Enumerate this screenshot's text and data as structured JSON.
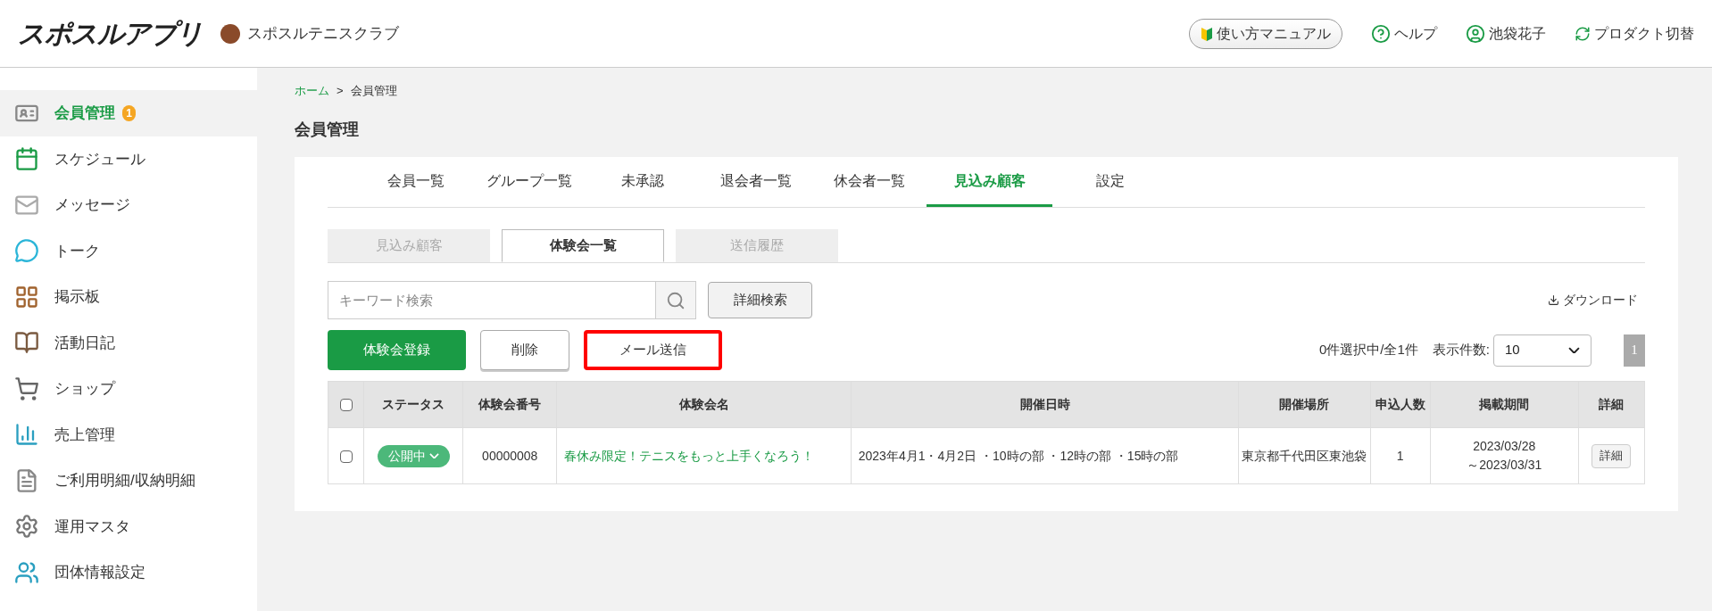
{
  "header": {
    "logo": "スポスルアプリ",
    "club": "スポスルテニスクラブ",
    "manual_button": "使い方マニュアル",
    "help": "ヘルプ",
    "user": "池袋花子",
    "switch": "プロダクト切替"
  },
  "sidebar": {
    "items": [
      {
        "label": "会員管理",
        "selected": true,
        "badge": "1"
      },
      {
        "label": "スケジュール",
        "selected": false
      },
      {
        "label": "メッセージ",
        "selected": false
      },
      {
        "label": "トーク",
        "selected": false
      },
      {
        "label": "掲示板",
        "selected": false
      },
      {
        "label": "活動日記",
        "selected": false
      },
      {
        "label": "ショップ",
        "selected": false
      },
      {
        "label": "売上管理",
        "selected": false
      },
      {
        "label": "ご利用明細/収納明細",
        "selected": false
      },
      {
        "label": "運用マスタ",
        "selected": false
      },
      {
        "label": "団体情報設定",
        "selected": false
      }
    ]
  },
  "breadcrumb": [
    "ホーム",
    "会員管理"
  ],
  "breadcrumb_separator": ">",
  "page_title": "会員管理",
  "tabs": [
    {
      "label": "会員一覧",
      "selected": false
    },
    {
      "label": "グループ一覧",
      "selected": false
    },
    {
      "label": "未承認",
      "selected": false
    },
    {
      "label": "退会者一覧",
      "selected": false
    },
    {
      "label": "休会者一覧",
      "selected": false
    },
    {
      "label": "見込み顧客",
      "selected": true
    },
    {
      "label": "設定",
      "selected": false
    }
  ],
  "sub_tabs": [
    {
      "label": "見込み顧客",
      "selected": false
    },
    {
      "label": "体験会一覧",
      "selected": true
    },
    {
      "label": "送信履歴",
      "selected": false
    }
  ],
  "search": {
    "placeholder": "キーワード検索"
  },
  "advanced_search": "詳細検索",
  "download": "ダウンロード",
  "actions": [
    {
      "label": "体験会登録",
      "kind": "primary",
      "highlighted": false
    },
    {
      "label": "削除",
      "kind": "secondary",
      "highlighted": false
    },
    {
      "label": "メール送信",
      "kind": "plain",
      "highlighted": true
    }
  ],
  "selection_count": "0件選択中/全1件",
  "page_size_label": "表示件数:",
  "page_size": "10",
  "pages": [
    {
      "label": "1",
      "selected": true
    }
  ],
  "table": {
    "select_all_checked": false,
    "columns": [
      "ステータス",
      "体験会番号",
      "体験会名",
      "開催日時",
      "開催場所",
      "申込人数",
      "掲載期間",
      "詳細"
    ],
    "rows": [
      {
        "checked": false,
        "status": "公開中",
        "number": "00000008",
        "name": "春休み限定！テニスをもっと上手くなろう！",
        "date": "2023年4月1・4月2日 ・10時の部 ・12時の部 ・15時の部",
        "place": "東京都千代田区東池袋",
        "count": "1",
        "period": [
          "2023/03/28",
          "～2023/03/31"
        ],
        "detail": "詳細"
      }
    ]
  }
}
